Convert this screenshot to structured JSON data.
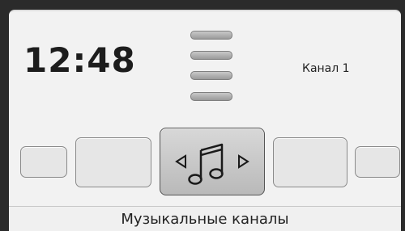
{
  "status": {
    "time": "12:48",
    "channel": "Канал 1"
  },
  "menu": {
    "icon": "hamburger-menu-icon",
    "bars": 4
  },
  "carousel": {
    "selected_icon": "music-note-icon",
    "left_arrow_icon": "triangle-left-icon",
    "right_arrow_icon": "triangle-right-icon"
  },
  "footer": {
    "label": "Музыкальные каналы"
  },
  "colors": {
    "background": "#f2f2f2",
    "bezel": "#2b2b2b",
    "text": "#1d1d1d"
  }
}
